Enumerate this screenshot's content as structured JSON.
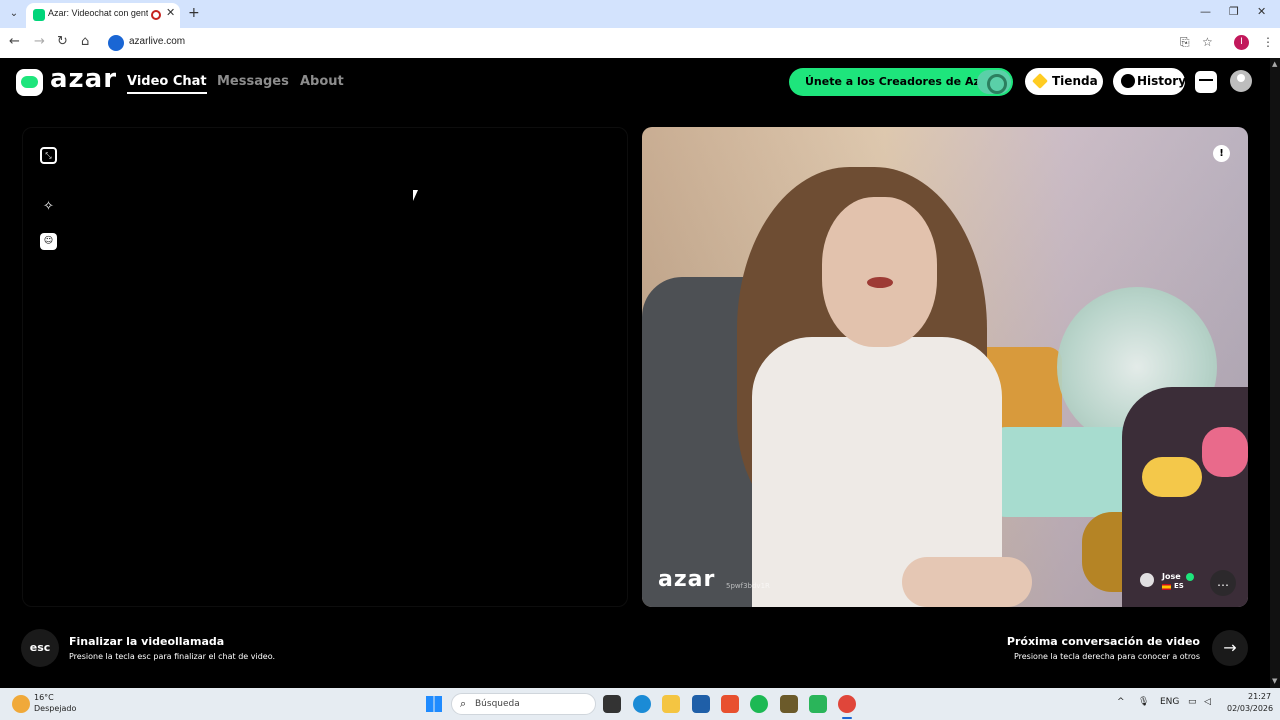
{
  "browser": {
    "tab_title": "Azar: Videochat con gente",
    "url": "azarlive.com",
    "profile_initial": "I"
  },
  "header": {
    "logo_text": "azar",
    "nav": [
      {
        "label": "Video Chat",
        "active": true
      },
      {
        "label": "Messages",
        "active": false
      },
      {
        "label": "About",
        "active": false
      }
    ],
    "creators_label": "Únete a los Creadores de Azar",
    "store_label": "Tienda",
    "history_label": "History"
  },
  "remote": {
    "watermark_logo": "azar",
    "watermark_id": "5pwf3bdv1R",
    "peer_name": "Jose",
    "peer_country": "ES"
  },
  "footer": {
    "esc_key": "esc",
    "end_title": "Finalizar la videollamada",
    "end_sub": "Presione la tecla esc para finalizar el chat de video.",
    "next_title": "Próxima conversación de video",
    "next_sub": "Presione la tecla derecha para conocer a otros"
  },
  "taskbar": {
    "temperature": "16°C",
    "weather": "Despejado",
    "search_placeholder": "Búsqueda",
    "language": "ENG",
    "time": "21:27",
    "date": "02/03/2026"
  },
  "colors": {
    "accent": "#1ee57c",
    "tab_strip": "#d3e3fd"
  }
}
